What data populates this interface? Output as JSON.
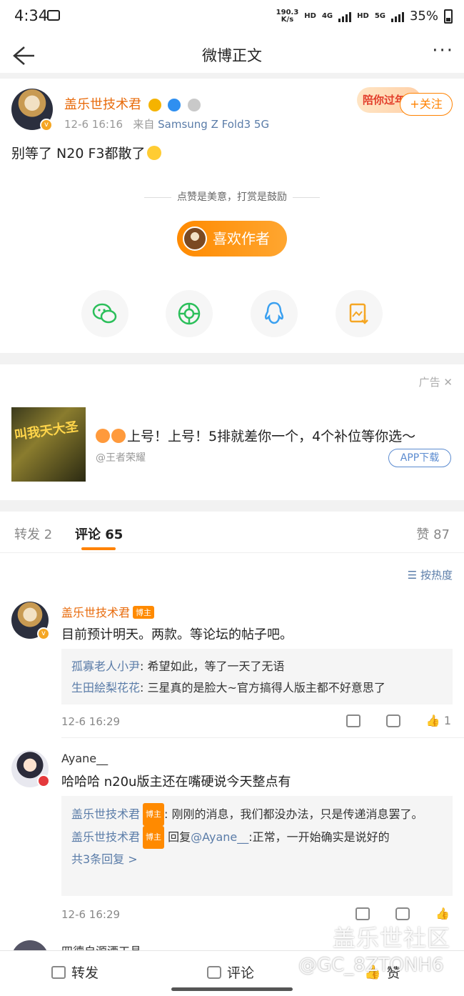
{
  "status_bar": {
    "time": "4:34",
    "net_speed_value": "190.3",
    "net_speed_unit": "K/s",
    "hd1": "HD",
    "g4": "4G",
    "hd2": "HD",
    "g5": "5G",
    "battery": "35%"
  },
  "nav": {
    "title": "微博正文"
  },
  "post": {
    "author": "盖乐世技术君",
    "time": "12-6 16:16",
    "source_prefix": "来自",
    "source": "Samsung Z Fold3 5G",
    "follow_label": "+关注",
    "badge_text": "陪你过年",
    "content": "别等了 N20 F3都散了",
    "reward_hint": "点赞是美意，打赏是鼓励",
    "like_author_label": "喜欢作者"
  },
  "share": {
    "icons": [
      "wechat-icon",
      "moments-icon",
      "qq-icon",
      "save-image-icon"
    ]
  },
  "ad": {
    "label": "广告",
    "image_text": "叫我天大圣",
    "text": "上号！上号！5排就差你一个，4个补位等你选～",
    "source": "@王者荣耀",
    "download_label": "APP下载"
  },
  "tabs": {
    "repost": "转发 2",
    "comments": "评论 65",
    "likes": "赞 87"
  },
  "sort_label": "按热度",
  "comments": [
    {
      "name": "盖乐世技术君",
      "badge": "博主",
      "text": "目前预计明天。两款。等论坛的帖子吧。",
      "replies": [
        {
          "who": "孤寡老人小尹",
          "text": ": 希望如此，等了一天了无语"
        },
        {
          "who": "生田絵梨花花",
          "text": ": 三星真的是脸大~官方搞得人版主都不好意思了"
        }
      ],
      "time": "12-6 16:29",
      "likes": "1"
    },
    {
      "name": "Ayane__",
      "text": "哈哈哈 n20u版主还在嘴硬说今天整点有",
      "reply1_who": "盖乐世技术君",
      "reply1_badge": "博主",
      "reply1_text": ": 刚刚的消息，我们都没办法，只是传递消息罢了。",
      "reply2_who": "盖乐世技术君",
      "reply2_badge": "博主",
      "reply2_mid": " 回复",
      "reply2_mention": "@Ayane__",
      "reply2_text": ":正常，一开始确实是说好的",
      "more_replies": "共3条回复 >",
      "time": "12-6 16:29"
    }
  ],
  "third_comment_name": "四德自源酒工具",
  "bottom_bar": {
    "repost": "转发",
    "comment": "评论",
    "like": "赞"
  },
  "watermark": {
    "line1": "盖乐世社区",
    "line2": "@GC_8ZTONH6"
  },
  "colors": {
    "accent": "#ff8200",
    "author": "#e86b0c",
    "link": "#5a7ca8"
  }
}
